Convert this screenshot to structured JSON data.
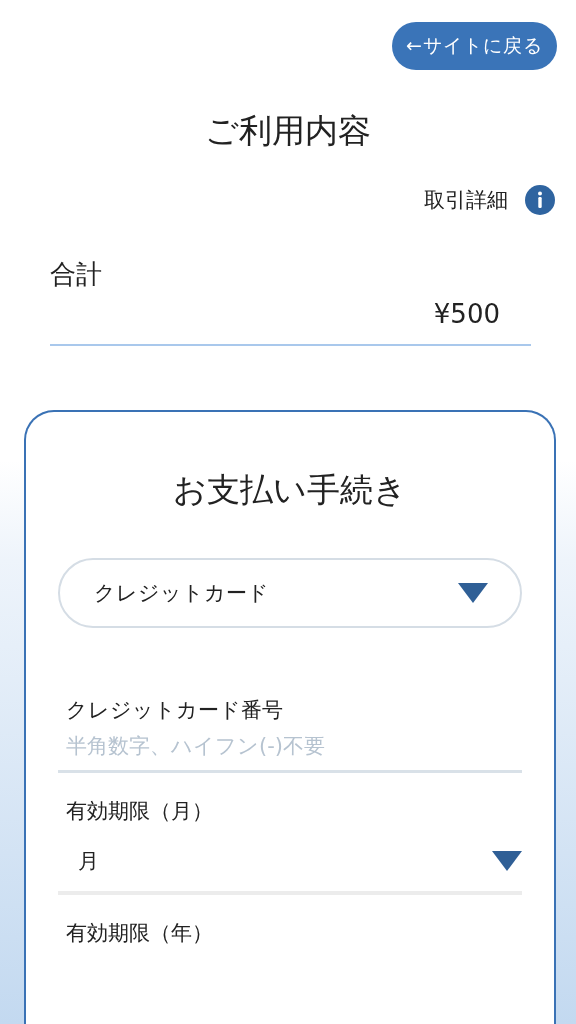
{
  "back_button": {
    "label": "←サイトに戻る"
  },
  "title": "ご利用内容",
  "details_link": {
    "label": "取引詳細"
  },
  "total": {
    "label": "合計",
    "value": "¥500"
  },
  "payment": {
    "title": "お支払い手続き",
    "method": {
      "value": "クレジットカード"
    },
    "fields": [
      {
        "kind": "text",
        "label": "クレジットカード番号",
        "placeholder": "半角数字、ハイフン(-)不要"
      },
      {
        "kind": "select",
        "label": "有効期限（月）",
        "value": "月"
      },
      {
        "kind": "heading",
        "label": "有効期限（年）"
      }
    ]
  }
}
